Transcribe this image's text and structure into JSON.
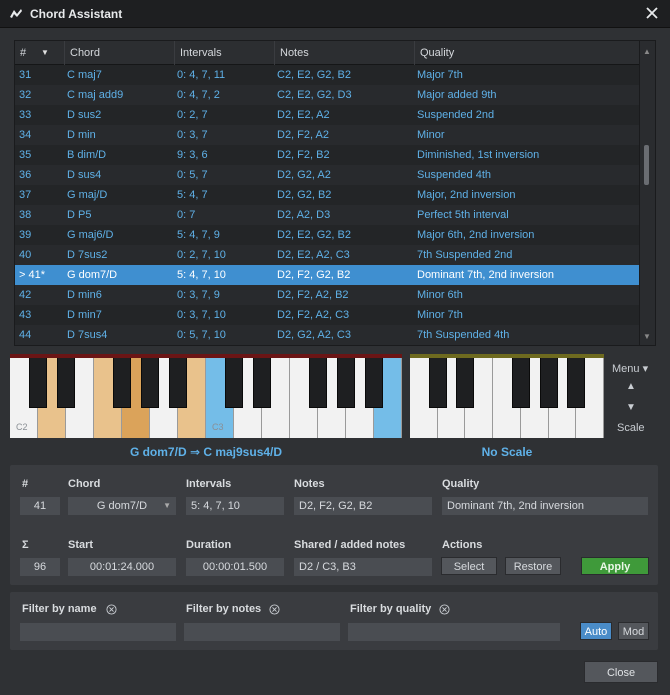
{
  "window": {
    "title": "Chord Assistant"
  },
  "table": {
    "headers": [
      "#",
      "Chord",
      "Intervals",
      "Notes",
      "Quality"
    ],
    "rows": [
      {
        "num": "31",
        "chord": "C maj7",
        "intervals": "0: 4, 7, 11",
        "notes": "C2, E2, G2, B2",
        "quality": "Major 7th"
      },
      {
        "num": "32",
        "chord": "C maj add9",
        "intervals": "0: 4, 7, 2",
        "notes": "C2, E2, G2, D3",
        "quality": "Major added 9th"
      },
      {
        "num": "33",
        "chord": "D sus2",
        "intervals": "0: 2, 7",
        "notes": "D2, E2, A2",
        "quality": "Suspended 2nd"
      },
      {
        "num": "34",
        "chord": "D min",
        "intervals": "0: 3, 7",
        "notes": "D2, F2, A2",
        "quality": "Minor"
      },
      {
        "num": "35",
        "chord": "B dim/D",
        "intervals": "9: 3, 6",
        "notes": "D2, F2, B2",
        "quality": "Diminished, 1st inversion"
      },
      {
        "num": "36",
        "chord": "D sus4",
        "intervals": "0: 5, 7",
        "notes": "D2, G2, A2",
        "quality": "Suspended 4th"
      },
      {
        "num": "37",
        "chord": "G maj/D",
        "intervals": "5: 4, 7",
        "notes": "D2, G2, B2",
        "quality": "Major, 2nd inversion"
      },
      {
        "num": "38",
        "chord": "D P5",
        "intervals": "0: 7",
        "notes": "D2, A2, D3",
        "quality": "Perfect 5th interval"
      },
      {
        "num": "39",
        "chord": "G maj6/D",
        "intervals": "5: 4, 7, 9",
        "notes": "D2, E2, G2, B2",
        "quality": "Major 6th, 2nd inversion"
      },
      {
        "num": "40",
        "chord": "D 7sus2",
        "intervals": "0: 2, 7, 10",
        "notes": "D2, E2, A2, C3",
        "quality": "7th Suspended 2nd"
      },
      {
        "num": "> 41*",
        "chord": "G dom7/D",
        "intervals": "5: 4, 7, 10",
        "notes": "D2, F2, G2, B2",
        "quality": "Dominant 7th, 2nd inversion"
      },
      {
        "num": "42",
        "chord": "D min6",
        "intervals": "0: 3, 7, 9",
        "notes": "D2, F2, A2, B2",
        "quality": "Minor 6th"
      },
      {
        "num": "43",
        "chord": "D min7",
        "intervals": "0: 3, 7, 10",
        "notes": "D2, F2, A2, C3",
        "quality": "Minor 7th"
      },
      {
        "num": "44",
        "chord": "D 7sus4",
        "intervals": "0: 5, 7, 10",
        "notes": "D2, G2, A2, C3",
        "quality": "7th Suspended 4th"
      }
    ],
    "selected_index": 10
  },
  "keyboard": {
    "label_c2": "C2",
    "label_c3": "C3",
    "chord_caption": "G dom7/D ⇒ C maj9sus4/D",
    "scale_caption": "No Scale"
  },
  "side": {
    "menu": "Menu ▾",
    "up": "▲",
    "down": "▼",
    "scale": "Scale"
  },
  "details": {
    "labels": {
      "num": "#",
      "chord": "Chord",
      "intervals": "Intervals",
      "notes": "Notes",
      "quality": "Quality",
      "sigma": "Σ",
      "start": "Start",
      "duration": "Duration",
      "shared": "Shared / added notes",
      "actions": "Actions"
    },
    "values": {
      "num": "41",
      "chord": "G dom7/D",
      "intervals": "5: 4, 7, 10",
      "notes": "D2, F2, G2, B2",
      "quality": "Dominant 7th, 2nd inversion",
      "sigma": "96",
      "start": "00:01:24.000",
      "duration": "00:00:01.500",
      "shared": "D2 / C3, B3"
    },
    "buttons": {
      "select": "Select",
      "restore": "Restore",
      "apply": "Apply"
    }
  },
  "filters": {
    "by_name": "Filter by name",
    "by_notes": "Filter by notes",
    "by_quality": "Filter by quality",
    "auto": "Auto",
    "mod": "Mod"
  },
  "close_label": "Close",
  "colors": {
    "accent": "#3f8fd0",
    "row_text": "#5fb1e8",
    "apply_green": "#3f9a3a",
    "key_highlight": "#e9c28c",
    "key_root": "#dba35a",
    "key_blue": "#74bde8"
  }
}
